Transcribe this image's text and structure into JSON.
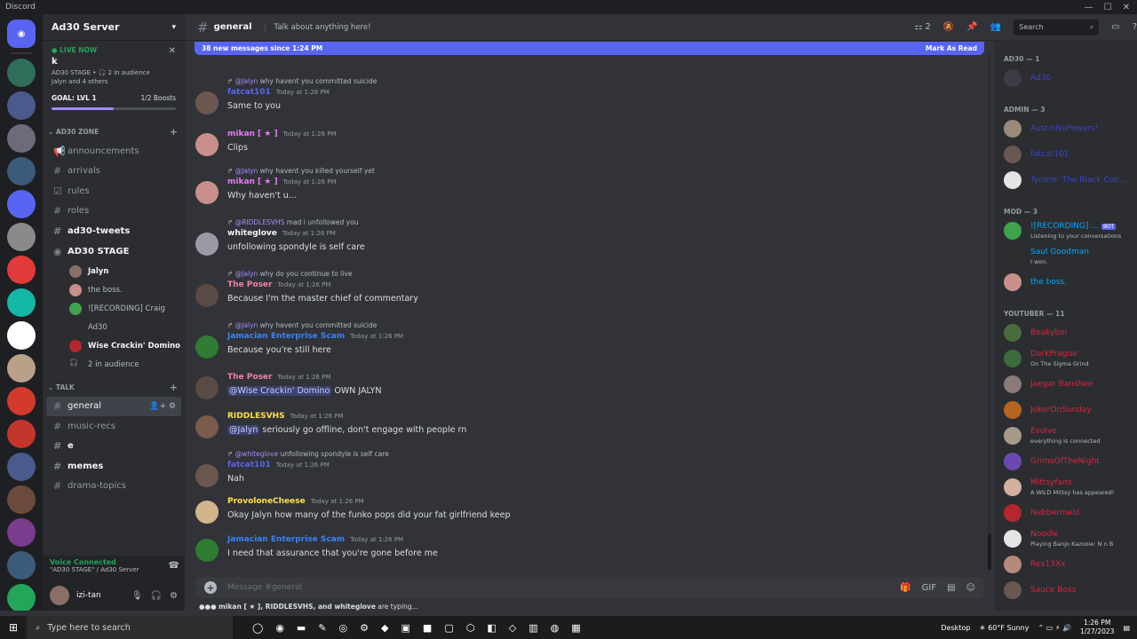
{
  "window": {
    "title": "Discord"
  },
  "guilds": [
    {
      "icon": "discord-home-icon",
      "color": "#5865f2"
    },
    {
      "color": "#2f6e5a"
    },
    {
      "color": "#4a5a8c"
    },
    {
      "color": "#6b6b7a"
    },
    {
      "color": "#3c5a7a"
    },
    {
      "color": "#5865f2"
    },
    {
      "color": "#8a8a8a"
    },
    {
      "color": "#e23a3a"
    },
    {
      "color": "#14b8a6"
    },
    {
      "color": "#ffffff"
    },
    {
      "color": "#b8a089"
    },
    {
      "color": "#d33a2c"
    },
    {
      "color": "#c2362c"
    },
    {
      "color": "#4a5a8c"
    },
    {
      "color": "#6b4a3c"
    },
    {
      "color": "#7a3c8c"
    },
    {
      "color": "#3c5a7a"
    },
    {
      "color": "#23a55a"
    }
  ],
  "server": {
    "name": "Ad30 Server"
  },
  "live": {
    "label": "LIVE NOW",
    "title": "k",
    "stage": "AD30 STAGE • 🎧 2 in audience",
    "people": "Jalyn and 4 others"
  },
  "goal": {
    "label": "GOAL: LVL 1",
    "boosts": "1/2 Boosts",
    "progress": 0.5
  },
  "categories": {
    "zone": "AD30 ZONE",
    "talk": "TALK"
  },
  "channels_zone": [
    "announcements",
    "arrivals",
    "rules",
    "roles",
    "ad30-tweets"
  ],
  "stage": {
    "name": "AD30 STAGE",
    "sub": "k"
  },
  "stage_users": [
    "Jalyn",
    "the boss.",
    "![RECORDING] Craig",
    "Ad30",
    "Wise Crackin' Domino",
    "2 in audience"
  ],
  "channels_talk": [
    "general",
    "music-recs",
    "e",
    "memes",
    "drama-topics"
  ],
  "voice": {
    "status": "Voice Connected",
    "where": "\"AD30 STAGE\" / Ad30 Server"
  },
  "user": {
    "name": "izi-tan"
  },
  "header": {
    "channel": "general",
    "topic": "Talk about anything here!",
    "threads": "2",
    "search": "Search"
  },
  "banner": {
    "text": "38 new messages since 1:24 PM",
    "mark": "Mark As Read"
  },
  "messages": [
    {
      "reply_mention": "@Jalyn",
      "reply": " why havent you committed suicide",
      "author": "fatcat101",
      "color": "#5865f2",
      "time": "Today at 1:26 PM",
      "content": "Same to you",
      "avatar": "#6a5750"
    },
    {
      "author": "mikan [ ★ ]",
      "color": "#e879f9",
      "time": "Today at 1:26 PM",
      "content": "Clips",
      "avatar": "#c98f8a"
    },
    {
      "reply_mention": "@Jalyn",
      "reply": " why havent you killed yourself yet",
      "author": "mikan [ ★ ]",
      "color": "#e879f9",
      "time": "Today at 1:26 PM",
      "content": "Why haven't u...",
      "avatar": "#c98f8a"
    },
    {
      "reply_mention": "@RIDDLESVHS",
      "reply": " mad i unfollowed you",
      "author": "whiteglove",
      "color": "#f2f3f5",
      "time": "Today at 1:26 PM",
      "content": "unfollowing spondyle is self care",
      "avatar": "#9a9aa5"
    },
    {
      "reply_mention": "@Jalyn",
      "reply": " why do you continue to live",
      "author": "The Poser",
      "color": "#f47fa8",
      "time": "Today at 1:26 PM",
      "content": "Because I'm the master chief of commentary",
      "avatar": "#5a4a44"
    },
    {
      "reply_mention": "@Jalyn",
      "reply": " why havent you committed suicide",
      "author": "Jamacian Enterprise Scam",
      "color": "#3b82f6",
      "time": "Today at 1:26 PM",
      "content": "Because you're still here",
      "avatar": "#2e7d32"
    },
    {
      "author": "The Poser",
      "color": "#f47fa8",
      "time": "Today at 1:26 PM",
      "mention": "@Wise Crackin' Domino",
      "content": " OWN JALYN",
      "avatar": "#5a4a44"
    },
    {
      "author": "RIDDLESVHS",
      "color": "#fde047",
      "time": "Today at 1:26 PM",
      "mention": "@Jalyn",
      "content": " seriously go offline, don't engage with people rn",
      "avatar": "#7a5a4a"
    },
    {
      "reply_mention": "@whiteglove",
      "reply": " unfollowing spondyle is self care",
      "author": "fatcat101",
      "color": "#5865f2",
      "time": "Today at 1:26 PM",
      "content": "Nah",
      "avatar": "#6a5750"
    },
    {
      "author": "ProvoloneCheese",
      "color": "#fde047",
      "time": "Today at 1:26 PM",
      "content": "Okay Jalyn how many of the funko pops did your fat girlfriend keep",
      "avatar": "#d4b48c"
    },
    {
      "author": "Jamacian Enterprise Scam",
      "color": "#3b82f6",
      "time": "Today at 1:26 PM",
      "content": "I need that assurance that you're gone before me",
      "avatar": "#2e7d32"
    }
  ],
  "composer": {
    "placeholder": "Message #general"
  },
  "typing": {
    "users": "mikan [ ★ ], RIDDLESVHS, and whiteglove",
    "suffix": " are typing..."
  },
  "members": {
    "groups": [
      {
        "title": "AD30 — 1",
        "items": [
          {
            "name": "Ad30",
            "color": "#3b45c4",
            "avatar": "#3c3c46"
          }
        ]
      },
      {
        "title": "ADMIN — 3",
        "items": [
          {
            "name": "AustinNoPowers!",
            "color": "#3b45c4",
            "avatar": "#9a8a7a"
          },
          {
            "name": "fatcat101",
            "color": "#3b45c4",
            "avatar": "#6a5750"
          },
          {
            "name": "Tyrone: The Black Con...",
            "color": "#3b45c4",
            "avatar": "#e5e5e5"
          }
        ]
      },
      {
        "title": "MOD — 3",
        "items": [
          {
            "name": "![RECORDING] ...",
            "color": "#00a8fc",
            "avatar": "#3fa34d",
            "status": "Listening to your conversations",
            "bot": "BOT"
          },
          {
            "name": "Saul Goodman",
            "color": "#00a8fc",
            "avatar": "#2d2d2d",
            "status": "I won."
          },
          {
            "name": "the boss.",
            "color": "#00a8fc",
            "avatar": "#c98f8a"
          }
        ]
      },
      {
        "title": "YOUTUBER — 11",
        "items": [
          {
            "name": "Beakyboi",
            "color": "#d7263d",
            "avatar": "#4a6b3c"
          },
          {
            "name": "DarkPrague",
            "color": "#d7263d",
            "avatar": "#3c6b3c",
            "status": "On The Sigma Grind"
          },
          {
            "name": "Jaegar Banshee",
            "color": "#d7263d",
            "avatar": "#8a7a7a"
          },
          {
            "name": "JokerOnSunday",
            "color": "#d7263d",
            "avatar": "#b5651d"
          },
          {
            "name": "Evolve",
            "color": "#d7263d",
            "avatar": "#a89a8a",
            "status": "everything is connected"
          },
          {
            "name": "GrimsOfTheNight",
            "color": "#d7263d",
            "avatar": "#6a4ab0"
          },
          {
            "name": "Mittsyfans",
            "color": "#d7263d",
            "avatar": "#d4b0a0",
            "status": "A WILD Mittsy has appeared!"
          },
          {
            "name": "Nebbermaid",
            "color": "#d7263d",
            "avatar": "#b5262d"
          },
          {
            "name": "Noodle",
            "color": "#d7263d",
            "avatar": "#e5e5e5",
            "status": "Playing Banjo Kazooie: N n B"
          },
          {
            "name": "Rex13Xx",
            "color": "#d7263d",
            "avatar": "#b58a7a"
          },
          {
            "name": "Sauce Boss",
            "color": "#d7263d",
            "avatar": "#6a5750"
          }
        ]
      }
    ]
  },
  "taskbar": {
    "search": "Type here to search",
    "desktop": "Desktop",
    "weather": "60°F  Sunny",
    "time": "1:26 PM",
    "date": "1/27/2023"
  }
}
